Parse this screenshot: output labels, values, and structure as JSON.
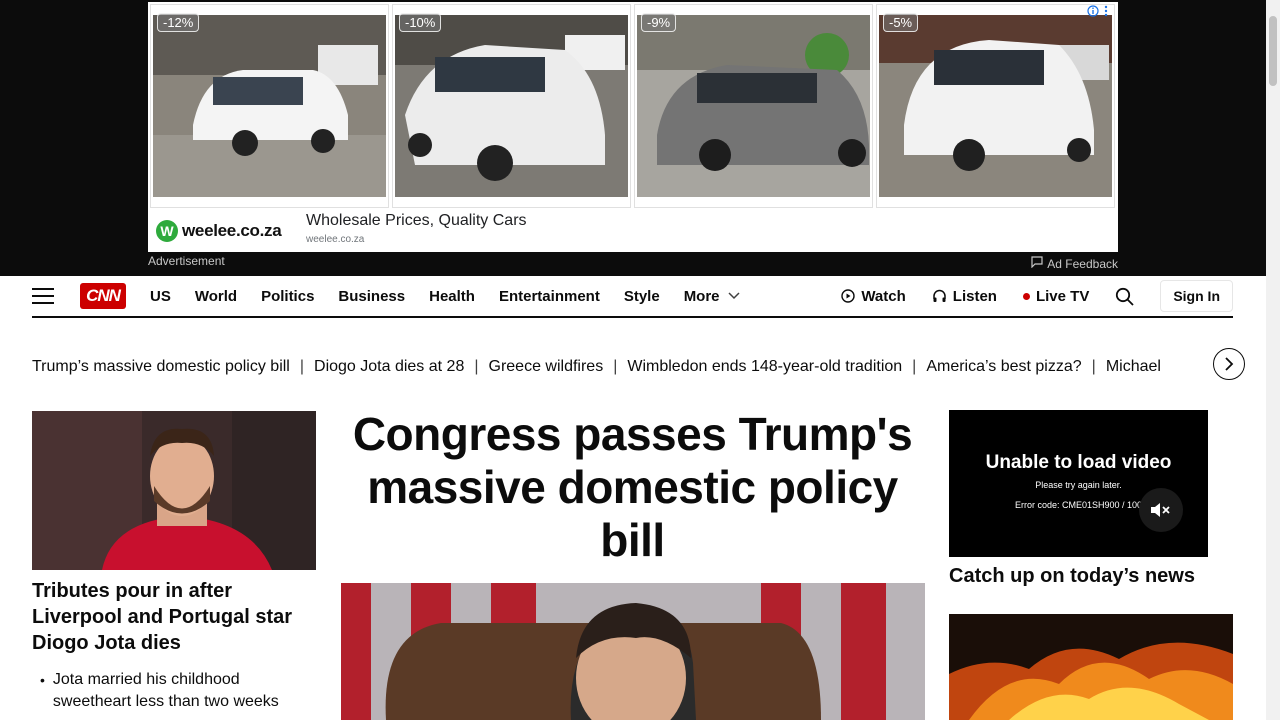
{
  "ad": {
    "cards": [
      {
        "discount": "-12%"
      },
      {
        "discount": "-10%"
      },
      {
        "discount": "-9%"
      },
      {
        "discount": "-5%"
      }
    ],
    "brand": "weelee.co.za",
    "headline": "Wholesale Prices, Quality Cars",
    "url": "weelee.co.za",
    "label": "Advertisement",
    "feedback": "Ad Feedback"
  },
  "nav": {
    "logo": "CNN",
    "links": [
      "US",
      "World",
      "Politics",
      "Business",
      "Health",
      "Entertainment",
      "Style",
      "More"
    ],
    "watch": "Watch",
    "listen": "Listen",
    "live_tv": "Live TV",
    "sign_in": "Sign In"
  },
  "trending": [
    "Trump’s massive domestic policy bill",
    "Diogo Jota dies at 28",
    "Greece wildfires",
    "Wimbledon ends 148-year-old tradition",
    "America’s best pizza?",
    "Michael"
  ],
  "left_story": {
    "headline": "Tributes pour in after Liverpool and Portugal star Diogo Jota dies",
    "bullet": "Jota married his childhood sweetheart less than two weeks"
  },
  "main_story": {
    "headline": "Congress passes Trump's massive domestic policy bill"
  },
  "video": {
    "title": "Unable to load video",
    "subtitle": "Please try again later.",
    "error": "Error code: CME01SH900 / 100",
    "caption": "Catch up on today’s news"
  },
  "colors": {
    "brand_red": "#cc0000",
    "text": "#0c0c0c",
    "ad_green": "#2eaa3c"
  }
}
